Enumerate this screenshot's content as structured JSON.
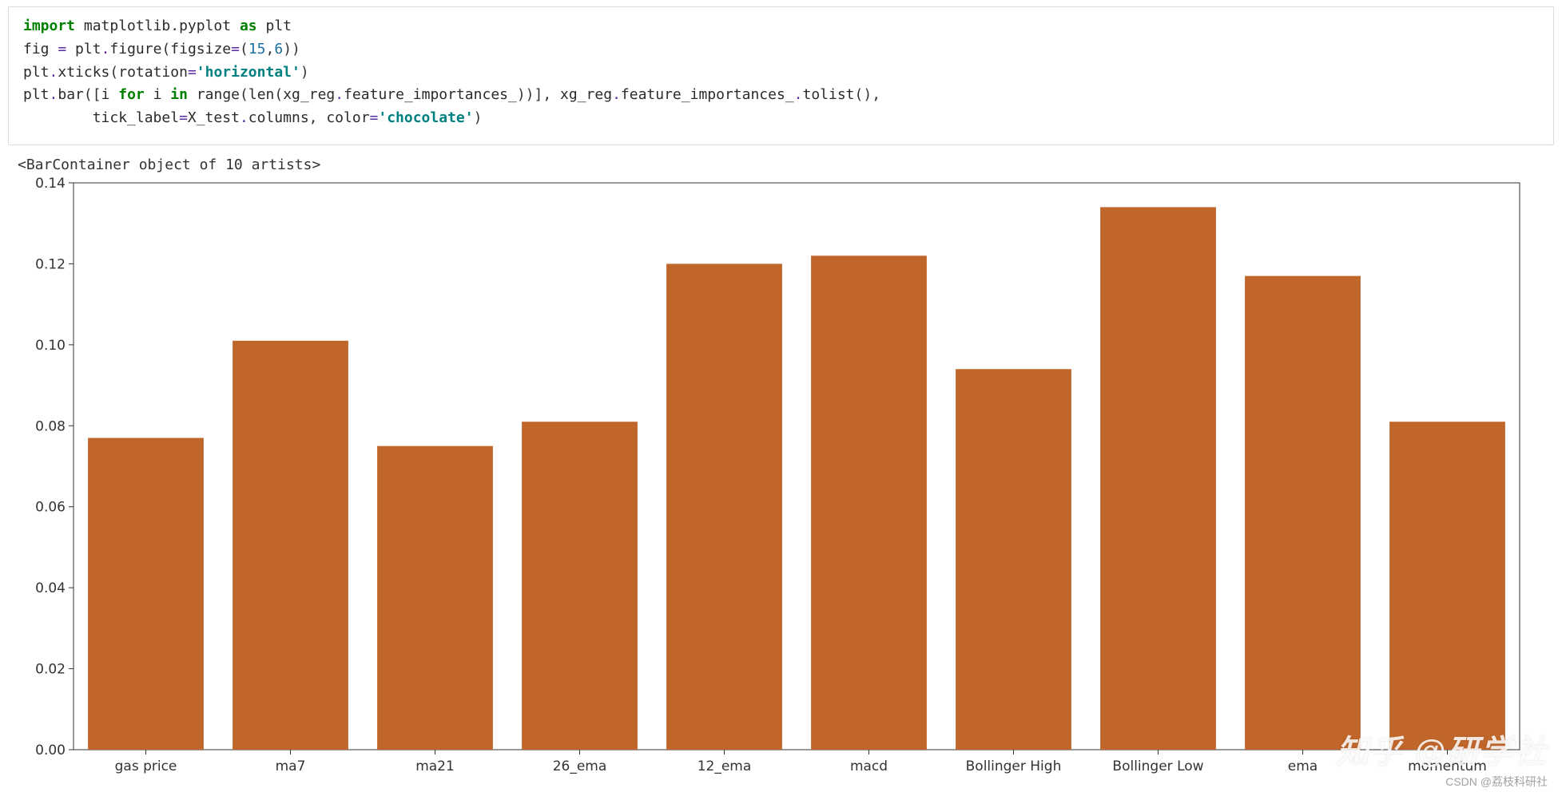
{
  "code": {
    "line1": {
      "import": "import",
      "mpl": "matplotlib.pyplot",
      "as": "as",
      "plt": "plt"
    },
    "line2": {
      "fig": "fig",
      "eq": "=",
      "plt": "plt",
      "figure": "figure",
      "figsize": "figsize",
      "n1": "15",
      "n2": "6"
    },
    "line3": {
      "plt": "plt",
      "xticks": "xticks",
      "rotation": "rotation",
      "horiz": "'horizontal'"
    },
    "line4": {
      "plt": "plt",
      "bar": "bar",
      "i1": "i",
      "for": "for",
      "i2": "i",
      "in": "in",
      "range": "range",
      "len": "len",
      "xg1": "xg_reg",
      "fi1": "feature_importances_",
      "xg2": "xg_reg",
      "fi2": "feature_importances_",
      "tolist": "tolist"
    },
    "line5": {
      "tick": "tick_label",
      "xtest": "X_test",
      "cols": "columns",
      "color": "color",
      "choc": "'chocolate'"
    }
  },
  "output_text": "<BarContainer object of 10 artists>",
  "chart_data": {
    "type": "bar",
    "categories": [
      "gas price",
      "ma7",
      "ma21",
      "26_ema",
      "12_ema",
      "macd",
      "Bollinger High",
      "Bollinger Low",
      "ema",
      "momentum"
    ],
    "values": [
      0.077,
      0.101,
      0.075,
      0.081,
      0.12,
      0.122,
      0.094,
      0.134,
      0.117,
      0.081
    ],
    "ylim": [
      0.0,
      0.14
    ],
    "yticks": [
      0.0,
      0.02,
      0.04,
      0.06,
      0.08,
      0.1,
      0.12,
      0.14
    ],
    "ytick_labels": [
      "0.00",
      "0.02",
      "0.04",
      "0.06",
      "0.08",
      "0.10",
      "0.12",
      "0.14"
    ],
    "bar_color": "#c1662a",
    "title": "",
    "xlabel": "",
    "ylabel": ""
  },
  "watermark": {
    "big": "知乎 @研学社",
    "small": "CSDN @荔枝科研社"
  }
}
